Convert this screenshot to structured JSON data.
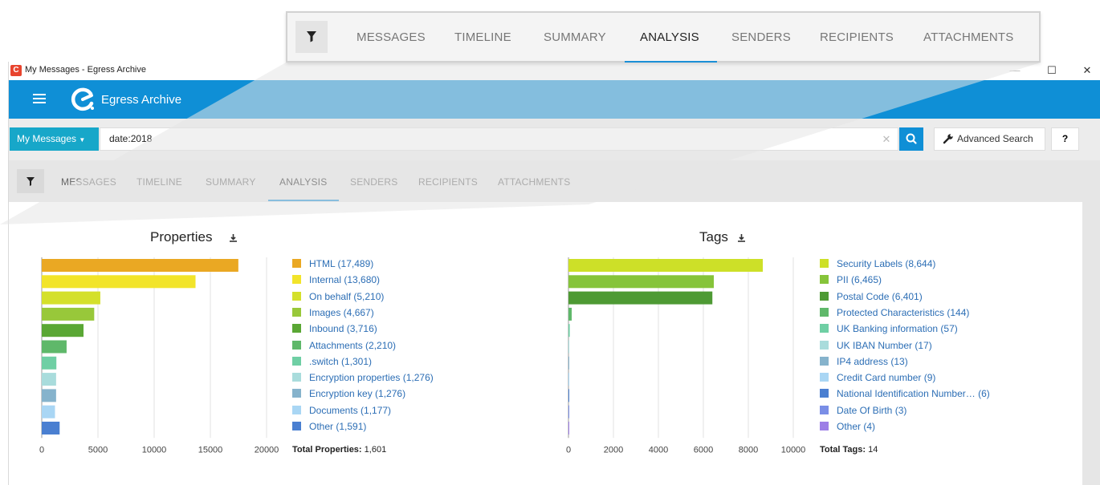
{
  "window": {
    "title": "My Messages - Egress Archive",
    "app_icon": "egress-app-icon",
    "controls": {
      "minimize": "—",
      "maximize": "☐",
      "close": "✕"
    }
  },
  "appbar": {
    "brand_name": "Egress Archive",
    "color": "#0f8fd6"
  },
  "search": {
    "scope_label": "My Messages",
    "query": "date:2018",
    "clear_glyph": "✕",
    "advanced_label": "Advanced Search",
    "help_label": "?"
  },
  "tabs": {
    "items": [
      "MESSAGES",
      "TIMELINE",
      "SUMMARY",
      "ANALYSIS",
      "SENDERS",
      "RECIPIENTS",
      "ATTACHMENTS"
    ],
    "active": "ANALYSIS"
  },
  "chart_data": [
    {
      "type": "bar",
      "orientation": "horizontal",
      "title": "Properties",
      "categories": [
        "HTML",
        "Internal",
        "On behalf",
        "Images",
        "Inbound",
        "Attachments",
        ".switch",
        "Encryption properties",
        "Encryption key",
        "Documents",
        "Other"
      ],
      "values": [
        17489,
        13680,
        5210,
        4667,
        3716,
        2210,
        1301,
        1276,
        1276,
        1177,
        1591
      ],
      "colors": [
        "#eaa823",
        "#f2e42a",
        "#d4e02b",
        "#98c83a",
        "#5aa734",
        "#5fb86a",
        "#6fcfa4",
        "#a9dcdc",
        "#86b3cc",
        "#a9d6f4",
        "#4a7fd1"
      ],
      "legend": [
        "HTML (17,489)",
        "Internal (13,680)",
        "On behalf (5,210)",
        "Images (4,667)",
        "Inbound (3,716)",
        "Attachments (2,210)",
        ".switch (1,301)",
        "Encryption properties (1,276)",
        "Encryption key (1,276)",
        "Documents (1,177)",
        "Other (1,591)"
      ],
      "xlim": [
        0,
        20000
      ],
      "xticks": [
        0,
        5000,
        10000,
        15000,
        20000
      ],
      "grid": true,
      "total_label": "Total Properties:",
      "total_value": "1,601"
    },
    {
      "type": "bar",
      "orientation": "horizontal",
      "title": "Tags",
      "categories": [
        "Security Labels",
        "PII",
        "Postal Code",
        "Protected Characteristics",
        "UK Banking information",
        "UK IBAN Number",
        "IP4 address",
        "Credit Card number",
        "National Identification Number…",
        "Date Of Birth",
        "Other"
      ],
      "values": [
        8644,
        6465,
        6401,
        144,
        57,
        17,
        13,
        9,
        6,
        3,
        4
      ],
      "colors": [
        "#cde028",
        "#86c43a",
        "#4e9a34",
        "#5fb86a",
        "#6fcfa4",
        "#a9dcdc",
        "#86b3cc",
        "#a9d6f4",
        "#4a7fd1",
        "#7a8ee6",
        "#9d7ee6"
      ],
      "legend": [
        "Security Labels (8,644)",
        "PII (6,465)",
        "Postal Code (6,401)",
        "Protected Characteristics (144)",
        "UK Banking information (57)",
        "UK IBAN Number (17)",
        "IP4 address (13)",
        "Credit Card number (9)",
        "National Identification Number… (6)",
        "Date Of Birth (3)",
        "Other (4)"
      ],
      "xlim": [
        0,
        10000
      ],
      "xticks": [
        0,
        2000,
        4000,
        6000,
        8000,
        10000
      ],
      "grid": true,
      "total_label": "Total Tags:",
      "total_value": "14"
    }
  ]
}
